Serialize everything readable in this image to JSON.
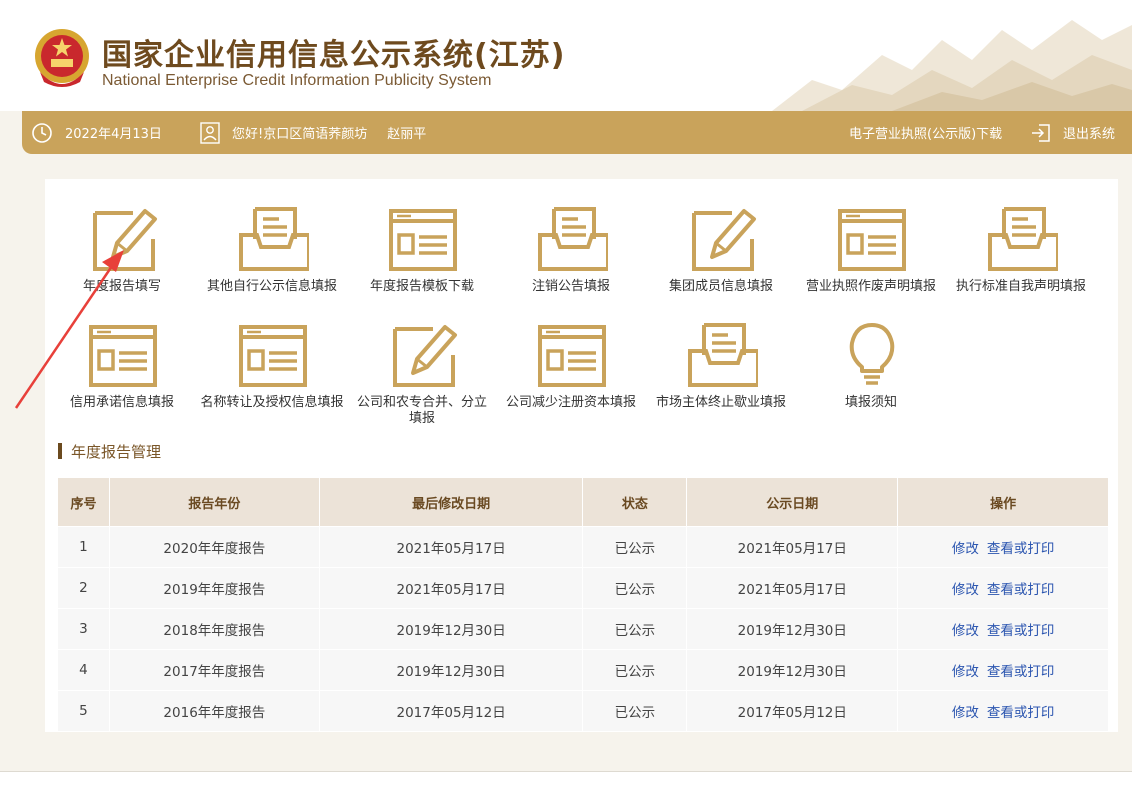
{
  "header": {
    "title_cn": "国家企业信用信息公示系统(江苏)",
    "title_en": "National Enterprise Credit Information Publicity System"
  },
  "topbar": {
    "date": "2022年4月13日",
    "greeting": "您好!京口区简语荞颜坊",
    "user": "赵丽平",
    "license_download": "电子营业执照(公示版)下载",
    "logout": "退出系统"
  },
  "tiles": [
    {
      "label": "年度报告填写",
      "icon": "pencil-form-icon"
    },
    {
      "label": "其他自行公示信息填报",
      "icon": "tray-doc-icon"
    },
    {
      "label": "年度报告模板下载",
      "icon": "template-icon"
    },
    {
      "label": "注销公告填报",
      "icon": "tray-doc-icon"
    },
    {
      "label": "集团成员信息填报",
      "icon": "pencil-form-icon"
    },
    {
      "label": "营业执照作废声明填报",
      "icon": "template-icon"
    },
    {
      "label": "执行标准自我声明填报",
      "icon": "tray-doc-icon"
    },
    {
      "label": "信用承诺信息填报",
      "icon": "template-icon"
    },
    {
      "label": "名称转让及授权信息填报",
      "icon": "template-icon"
    },
    {
      "label": "公司和农专合并、分立填报",
      "icon": "pencil-form-icon"
    },
    {
      "label": "公司减少注册资本填报",
      "icon": "template-icon"
    },
    {
      "label": "市场主体终止歇业填报",
      "icon": "tray-doc-icon"
    },
    {
      "label": "填报须知",
      "icon": "lightbulb-icon"
    }
  ],
  "section": {
    "title": "年度报告管理"
  },
  "table": {
    "headers": [
      "序号",
      "报告年份",
      "最后修改日期",
      "状态",
      "公示日期",
      "操作"
    ],
    "actions": {
      "edit": "修改",
      "view": "查看或打印"
    },
    "rows": [
      [
        "1",
        "2020年年度报告",
        "2021年05月17日",
        "已公示",
        "2021年05月17日"
      ],
      [
        "2",
        "2019年年度报告",
        "2021年05月17日",
        "已公示",
        "2021年05月17日"
      ],
      [
        "3",
        "2018年年度报告",
        "2019年12月30日",
        "已公示",
        "2019年12月30日"
      ],
      [
        "4",
        "2017年年度报告",
        "2019年12月30日",
        "已公示",
        "2019年12月30日"
      ],
      [
        "5",
        "2016年年度报告",
        "2017年05月12日",
        "已公示",
        "2017年05月12日"
      ]
    ]
  },
  "colors": {
    "accent": "#c9a35b",
    "brand": "#6e4a1e",
    "link": "#2c56b0",
    "annotation": "#e8403a"
  }
}
